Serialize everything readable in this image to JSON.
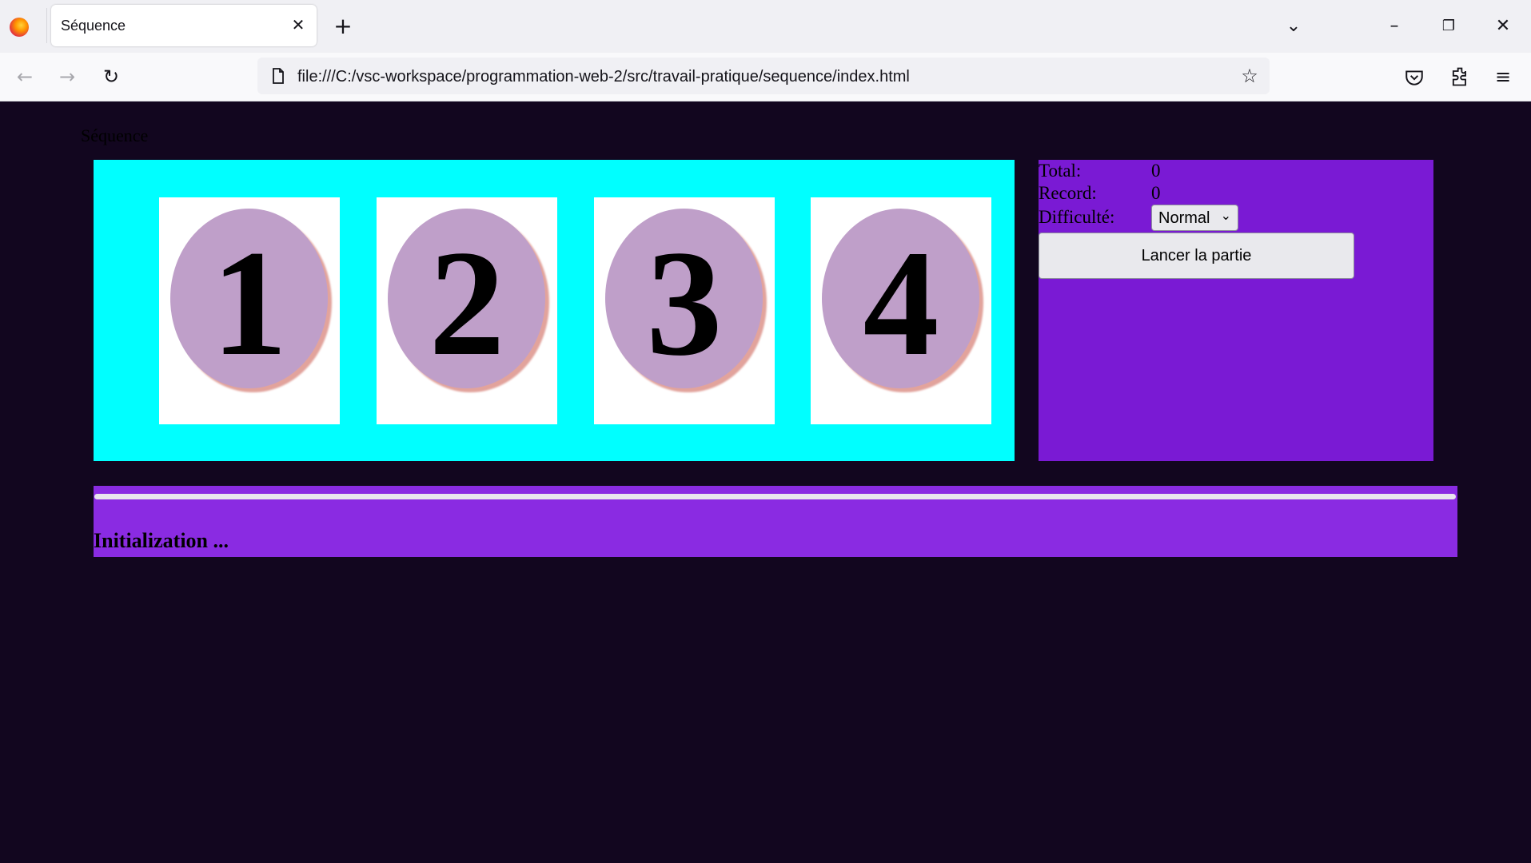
{
  "browser": {
    "tab_title": "Séquence",
    "url": "file:///C:/vsc-workspace/programmation-web-2/src/travail-pratique/sequence/index.html"
  },
  "page": {
    "heading": "Séquence",
    "cards": [
      {
        "digit": "1"
      },
      {
        "digit": "2"
      },
      {
        "digit": "3"
      },
      {
        "digit": "4"
      }
    ],
    "score": {
      "total_label": "Total:",
      "total_value": "0",
      "record_label": "Record:",
      "record_value": "0",
      "difficulty_label": "Difficulté:",
      "difficulty_value": "Normal"
    },
    "start_button": "Lancer la partie",
    "progress_fraction": 0,
    "status_message": "Initialization ..."
  },
  "colors": {
    "page_background": "#12061f",
    "board_background": "#00ffff",
    "score_panel_background": "#7a1ad4",
    "status_panel_background": "#8a2be2",
    "card_oval": "#bf9fc9"
  },
  "icons": [
    "firefox-logo-icon",
    "close-icon",
    "plus-icon",
    "chevron-down-icon",
    "minimize-icon",
    "restore-icon",
    "back-arrow-icon",
    "forward-arrow-icon",
    "reload-icon",
    "page-icon",
    "star-icon",
    "pocket-icon",
    "extensions-icon",
    "menu-icon"
  ]
}
